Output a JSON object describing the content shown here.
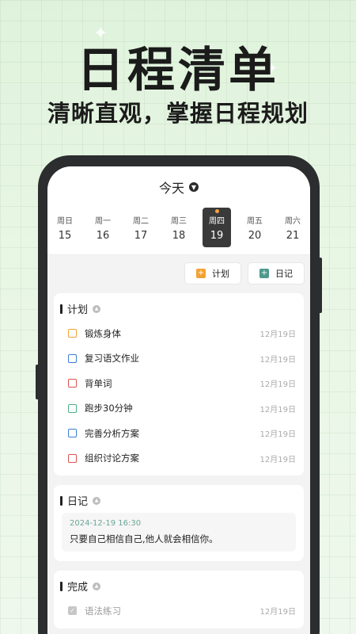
{
  "hero": {
    "title": "日程清单",
    "subtitle": "清晰直观，掌握日程规划"
  },
  "header": {
    "title": "今天"
  },
  "week": [
    {
      "name": "周日",
      "date": "15",
      "active": false
    },
    {
      "name": "周一",
      "date": "16",
      "active": false
    },
    {
      "name": "周二",
      "date": "17",
      "active": false
    },
    {
      "name": "周三",
      "date": "18",
      "active": false
    },
    {
      "name": "周四",
      "date": "19",
      "active": true
    },
    {
      "name": "周五",
      "date": "20",
      "active": false
    },
    {
      "name": "周六",
      "date": "21",
      "active": false
    }
  ],
  "actions": {
    "plan_label": "计划",
    "diary_label": "日记"
  },
  "plan": {
    "title": "计划",
    "items": [
      {
        "label": "锻炼身体",
        "date": "12月19日",
        "color": "#f2a233"
      },
      {
        "label": "复习语文作业",
        "date": "12月19日",
        "color": "#3d7ed6"
      },
      {
        "label": "背单词",
        "date": "12月19日",
        "color": "#d9534f"
      },
      {
        "label": "跑步30分钟",
        "date": "12月19日",
        "color": "#4fae86"
      },
      {
        "label": "完善分析方案",
        "date": "12月19日",
        "color": "#3d7ed6"
      },
      {
        "label": "组织讨论方案",
        "date": "12月19日",
        "color": "#d9534f"
      }
    ]
  },
  "diary": {
    "title": "日记",
    "entry": {
      "timestamp": "2024-12-19 16:30",
      "text": "只要自己相信自己,他人就会相信你。"
    }
  },
  "done": {
    "title": "完成",
    "items": [
      {
        "label": "语法练习",
        "date": "12月19日"
      }
    ]
  }
}
